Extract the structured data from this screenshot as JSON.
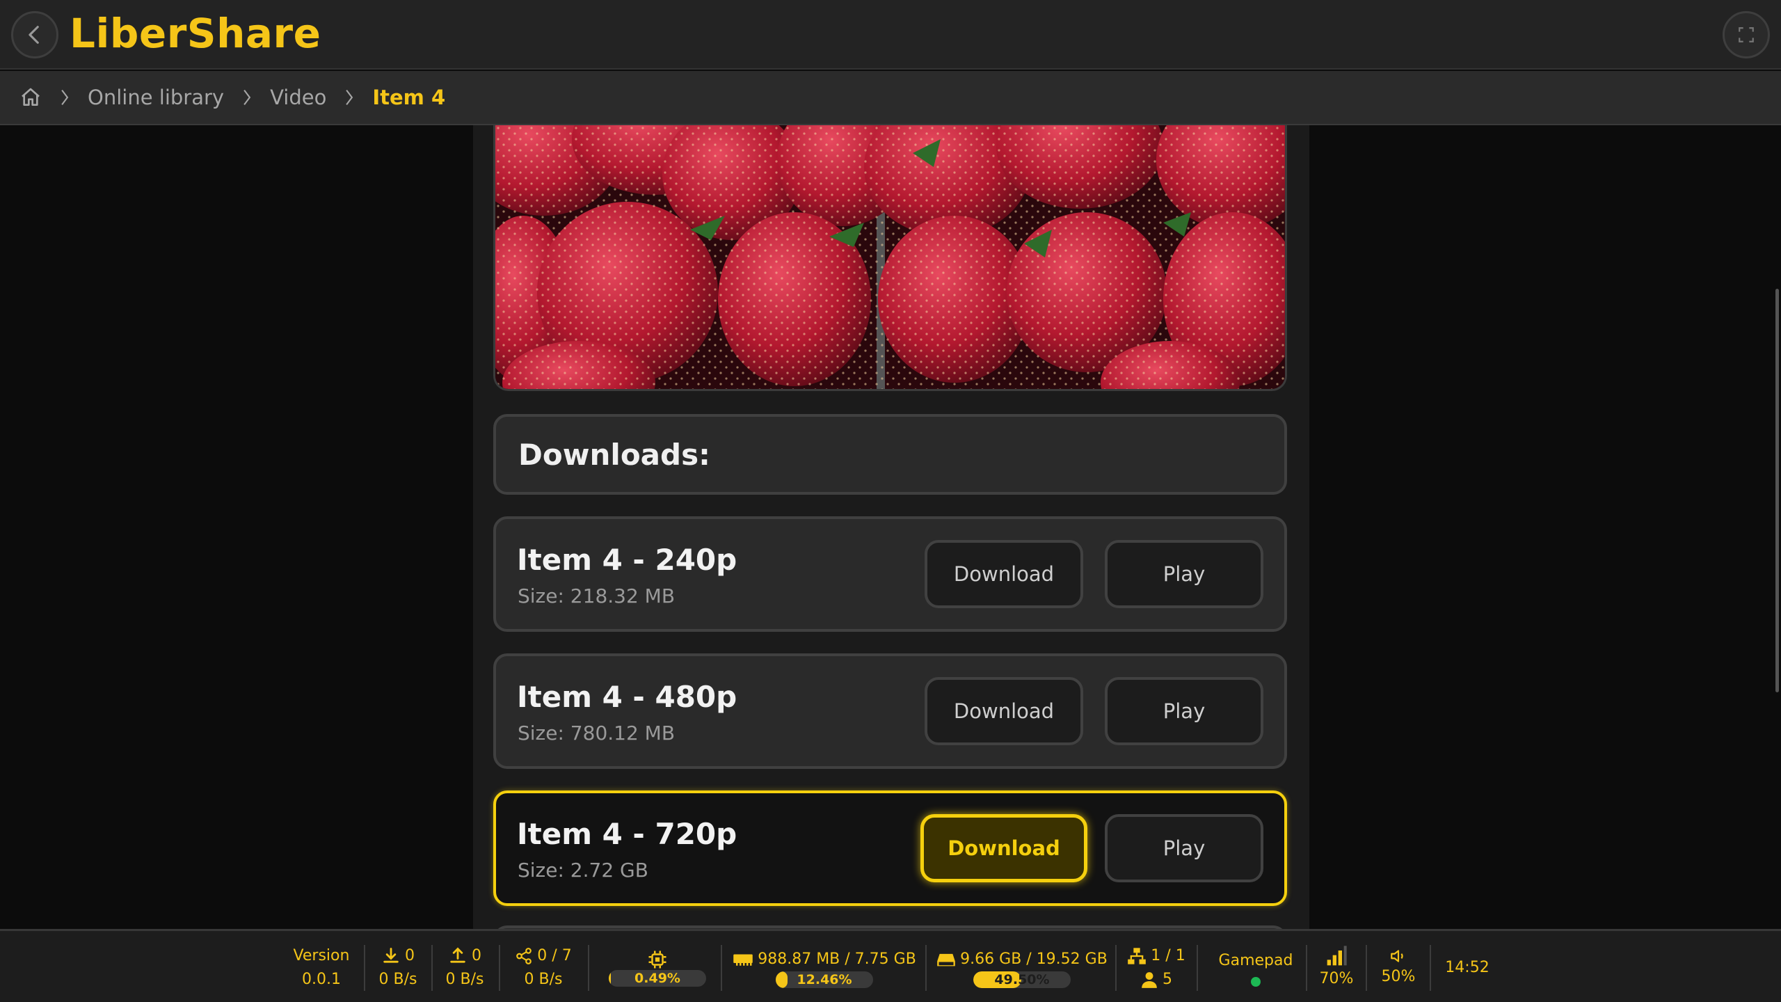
{
  "app": {
    "title": "LiberShare"
  },
  "breadcrumb": [
    "Online library",
    "Video",
    "Item 4"
  ],
  "downloads_title": "Downloads:",
  "items": [
    {
      "name": "Item 4 - 240p",
      "size": "Size: 218.32 MB",
      "download_label": "Download",
      "play_label": "Play"
    },
    {
      "name": "Item 4 - 480p",
      "size": "Size: 780.12 MB",
      "download_label": "Download",
      "play_label": "Play"
    },
    {
      "name": "Item 4 - 720p",
      "size": "Size: 2.72 GB",
      "download_label": "Download",
      "play_label": "Play"
    }
  ],
  "status": {
    "version_label": "Version",
    "version": "0.0.1",
    "download_count": "0",
    "download_speed": "0 B/s",
    "upload_count": "0",
    "upload_speed": "0 B/s",
    "peers": "0 / 7",
    "peers_speed": "0 B/s",
    "cpu_percent": "0.49%",
    "cpu_fraction": 0.0049,
    "ram": "988.87 MB / 7.75 GB",
    "ram_percent": "12.46%",
    "ram_fraction": 0.1246,
    "disk": "9.66 GB / 19.52 GB",
    "disk_percent": "49.50%",
    "disk_fraction": 0.495,
    "network": "1 / 1",
    "users": "5",
    "gamepad_label": "Gamepad",
    "signal": "70%",
    "volume": "50%",
    "clock": "14:52"
  },
  "colors": {
    "accent": "#f5c518",
    "focus": "#f5d00e",
    "ok": "#1db954"
  }
}
